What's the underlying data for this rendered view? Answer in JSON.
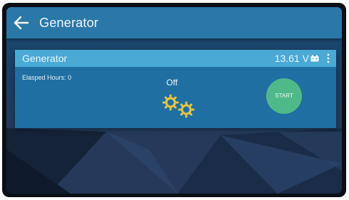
{
  "appbar": {
    "title": "Generator",
    "back_icon": "arrow-left-icon"
  },
  "generator_card": {
    "title": "Generator",
    "voltage": "13.61 V",
    "battery_icon": "battery-icon",
    "menu_icon": "more-vertical-icon",
    "elapsed_hours": "Elasped Hours: 0",
    "status": "Off",
    "status_icon": "gears-icon",
    "start_label": "START"
  },
  "colors": {
    "appbar": "#2a78a8",
    "card_header": "#4aa9d5",
    "card_body": "#1f6fa2",
    "start_button": "#4fb98a",
    "gears": "#e8c340"
  }
}
